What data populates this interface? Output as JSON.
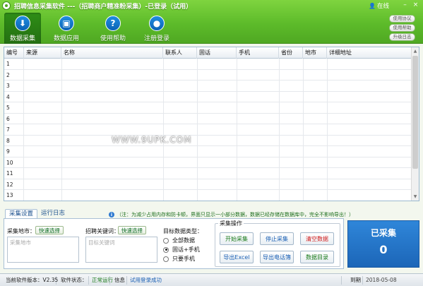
{
  "window": {
    "title": "招聘信息采集软件 ---（招聘商户精准粉采集）-已登录（试用）",
    "online": "在线",
    "minimize": "–",
    "close": "×"
  },
  "nav": [
    {
      "label": "数据采集",
      "glyph": "⬇",
      "icon": "download-icon"
    },
    {
      "label": "数据应用",
      "glyph": "▣",
      "icon": "android-icon"
    },
    {
      "label": "使用帮助",
      "glyph": "?",
      "icon": "help-icon"
    },
    {
      "label": "注册登录",
      "glyph": "●",
      "icon": "user-icon"
    }
  ],
  "side_buttons": [
    "使用协议",
    "使用帮助",
    "升级日志"
  ],
  "table": {
    "columns": [
      "编号",
      "来源",
      "名称",
      "联系人",
      "固话",
      "手机",
      "省份",
      "地市",
      "详细地址"
    ],
    "rows": [
      "1",
      "2",
      "3",
      "4",
      "5",
      "6",
      "7",
      "8",
      "9",
      "10",
      "11",
      "12",
      "13"
    ]
  },
  "watermark": "WWW.9UPK.COM",
  "tabs": [
    "采集设置",
    "运行日志"
  ],
  "info": {
    "icon": "i",
    "text": "（注：为减少占用内存和防卡顿，界面只显示一小部分数据，数据已经存储在数据库中，完全不影响导出！）"
  },
  "settings": {
    "area_label": "采集地市：",
    "area_button": "快速选择",
    "area_placeholder": "采集地市",
    "keyword_label": "招聘关键词：",
    "keyword_button": "快速选择",
    "keyword_placeholder": "目标关键词",
    "type_label": "目标数据类型：",
    "type_options": [
      {
        "label": "全部数据",
        "checked": false
      },
      {
        "label": "固话+手机",
        "checked": true
      },
      {
        "label": "只要手机",
        "checked": false
      }
    ]
  },
  "operations": {
    "legend": "采集操作",
    "buttons": [
      {
        "label": "开始采集",
        "color": "#1a7a1a"
      },
      {
        "label": "停止采集",
        "color": "#1a5fb4"
      },
      {
        "label": "清空数据",
        "color": "#d01818"
      },
      {
        "label": "导出Excel",
        "color": "#1a5fb4"
      },
      {
        "label": "导出电话簿",
        "color": "#1a5fb4"
      },
      {
        "label": "数据目录",
        "color": "#1a7a1a"
      }
    ]
  },
  "counter": {
    "label": "已采集",
    "value": "0"
  },
  "status_bar": {
    "version": "当前软件版本：V2.35",
    "state_label": "软件状态：",
    "state_value": "正常运行",
    "info_label": "信息",
    "info_value": "试用登录成功",
    "expire_label": "到期",
    "expire_value": "2018-05-08"
  }
}
